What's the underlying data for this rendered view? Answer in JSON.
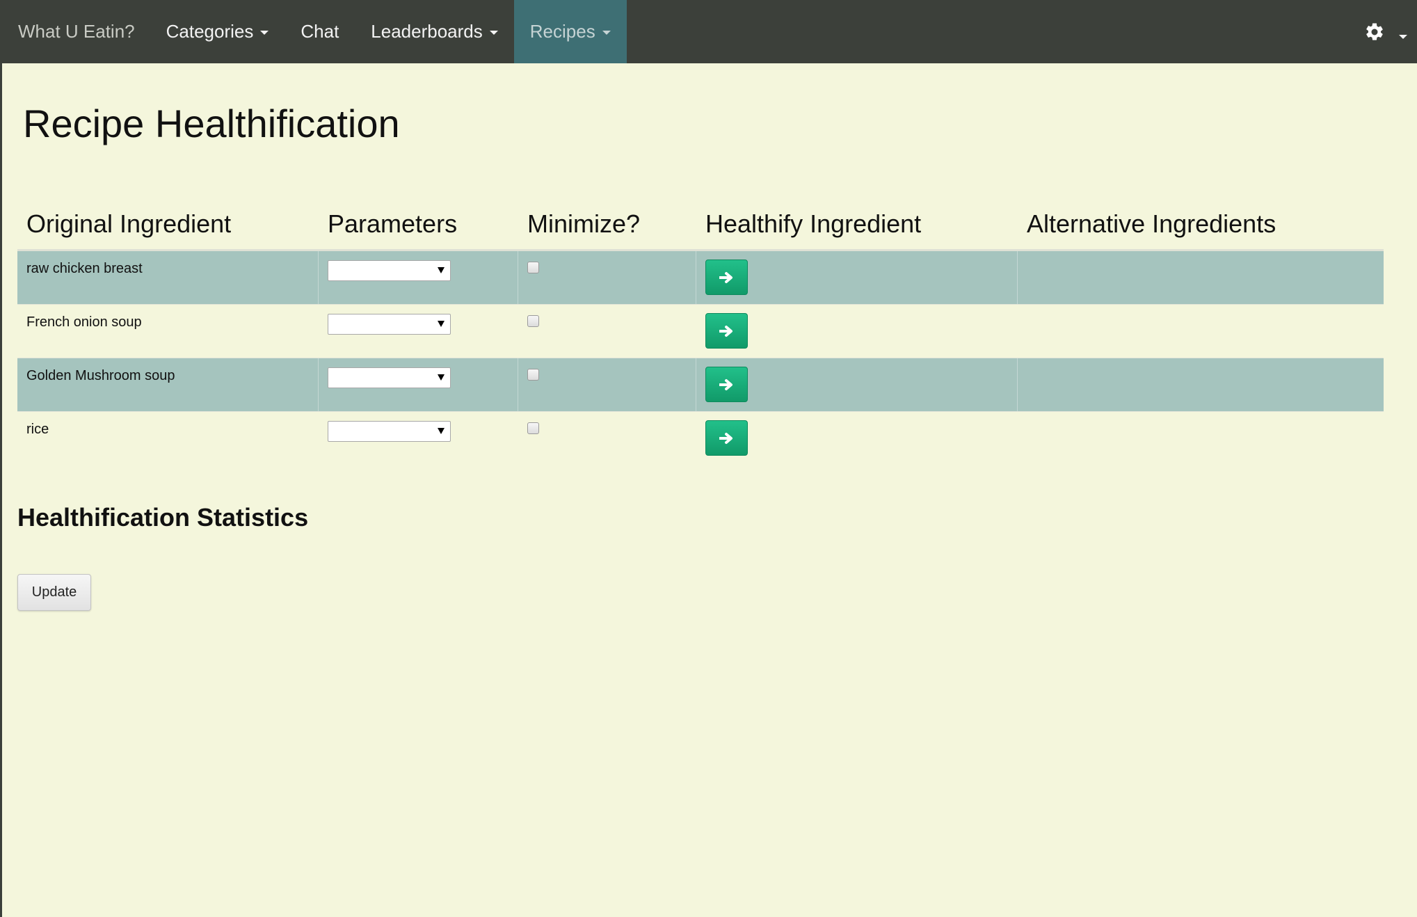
{
  "navbar": {
    "brand": "What U Eatin?",
    "items": [
      {
        "label": "Categories",
        "dropdown": true
      },
      {
        "label": "Chat",
        "dropdown": false
      },
      {
        "label": "Leaderboards",
        "dropdown": true
      },
      {
        "label": "Recipes",
        "dropdown": true,
        "active": true
      }
    ],
    "settings_icon": "gear-icon",
    "active_color": "#3e6f74",
    "background": "#3c403a"
  },
  "page_title": "Recipe Healthification",
  "table": {
    "headers": [
      "Original Ingredient",
      "Parameters",
      "Minimize?",
      "Healthify Ingredient",
      "Alternative Ingredients"
    ],
    "rows": [
      {
        "ingredient": "raw chicken breast",
        "parameter": "",
        "minimize": false,
        "alternatives": ""
      },
      {
        "ingredient": "French onion soup",
        "parameter": "",
        "minimize": false,
        "alternatives": ""
      },
      {
        "ingredient": "Golden Mushroom soup",
        "parameter": "",
        "minimize": false,
        "alternatives": ""
      },
      {
        "ingredient": "rice",
        "parameter": "",
        "minimize": false,
        "alternatives": ""
      }
    ],
    "healthify_icon": "arrow-right-icon",
    "stripe_color": "#a5c4be",
    "button_color": "#1aaf7a"
  },
  "stats": {
    "title": "Healthification Statistics",
    "update_label": "Update"
  },
  "colors": {
    "background": "#f4f6dc"
  }
}
